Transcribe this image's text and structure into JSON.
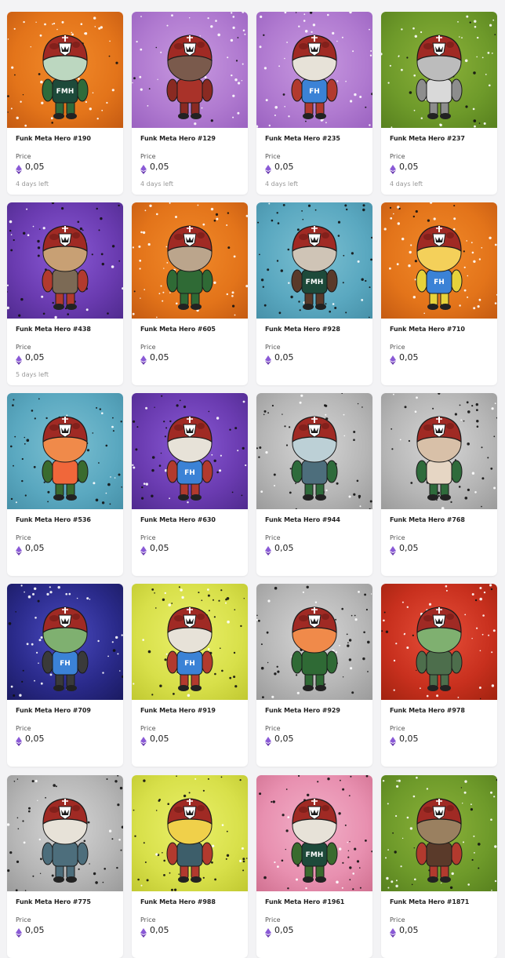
{
  "accent_color": "#8a5ad6",
  "price_label": "Price",
  "currency_icon": "ethereum-icon",
  "cards": [
    {
      "name": "Funk Meta Hero #190",
      "price": "0,05",
      "time_left": "4 days left",
      "bg": "orange",
      "shirt": "FMH",
      "shirt_color": "#1d4a3a",
      "skin": "#bcd7c0",
      "limbs": "#2e6b3b"
    },
    {
      "name": "Funk Meta Hero #129",
      "price": "0,05",
      "time_left": "4 days left",
      "bg": "purple",
      "shirt": "",
      "shirt_color": "#a93229",
      "skin": "#7a5a4c",
      "limbs": "#8a2a22"
    },
    {
      "name": "Funk Meta Hero #235",
      "price": "0,05",
      "time_left": "4 days left",
      "bg": "purple",
      "shirt": "FH",
      "shirt_color": "#3b82d6",
      "skin": "#e7e2d8",
      "limbs": "#b23a2e"
    },
    {
      "name": "Funk Meta Hero #237",
      "price": "0,05",
      "time_left": "4 days left",
      "bg": "green",
      "shirt": "",
      "shirt_color": "#d9d9d9",
      "skin": "#bcbcbc",
      "limbs": "#8d8d8d"
    },
    {
      "name": "Funk Meta Hero #438",
      "price": "0,05",
      "time_left": "5 days left",
      "bg": "violet",
      "shirt": "",
      "shirt_color": "#7c6a55",
      "skin": "#c8a074",
      "limbs": "#b23a2e"
    },
    {
      "name": "Funk Meta Hero #605",
      "price": "0,05",
      "time_left": "",
      "bg": "orange",
      "shirt": "",
      "shirt_color": "#2f6a35",
      "skin": "#bba58c",
      "limbs": "#2f6a35"
    },
    {
      "name": "Funk Meta Hero #928",
      "price": "0,05",
      "time_left": "",
      "bg": "teal",
      "shirt": "FMH",
      "shirt_color": "#1d4a3a",
      "skin": "#cfc4b6",
      "limbs": "#5a3a2a"
    },
    {
      "name": "Funk Meta Hero #710",
      "price": "0,05",
      "time_left": "",
      "bg": "orange",
      "shirt": "FH",
      "shirt_color": "#3b82d6",
      "skin": "#f4d05a",
      "limbs": "#e6d23a"
    },
    {
      "name": "Funk Meta Hero #536",
      "price": "0,05",
      "time_left": "",
      "bg": "teal",
      "shirt": "",
      "shirt_color": "#f0673a",
      "skin": "#f08a4a",
      "limbs": "#3a6b2e"
    },
    {
      "name": "Funk Meta Hero #630",
      "price": "0,05",
      "time_left": "",
      "bg": "violet",
      "shirt": "FH",
      "shirt_color": "#3b82d6",
      "skin": "#e7e2d8",
      "limbs": "#b23a2e"
    },
    {
      "name": "Funk Meta Hero #944",
      "price": "0,05",
      "time_left": "",
      "bg": "gray",
      "shirt": "",
      "shirt_color": "#4d6e7c",
      "skin": "#bcd0d6",
      "limbs": "#2e6b3b"
    },
    {
      "name": "Funk Meta Hero #768",
      "price": "0,05",
      "time_left": "",
      "bg": "gray",
      "shirt": "",
      "shirt_color": "#e6d6c4",
      "skin": "#d8c0a8",
      "limbs": "#2e6b3b"
    },
    {
      "name": "Funk Meta Hero #709",
      "price": "0,05",
      "time_left": "",
      "bg": "navy",
      "shirt": "FH",
      "shirt_color": "#3b82d6",
      "skin": "#7fb070",
      "limbs": "#3a3a3a"
    },
    {
      "name": "Funk Meta Hero #919",
      "price": "0,05",
      "time_left": "",
      "bg": "yellow",
      "shirt": "FH",
      "shirt_color": "#3b82d6",
      "skin": "#e7e2d8",
      "limbs": "#b23a2e"
    },
    {
      "name": "Funk Meta Hero #929",
      "price": "0,05",
      "time_left": "",
      "bg": "gray",
      "shirt": "",
      "shirt_color": "#2f6a35",
      "skin": "#f08a4a",
      "limbs": "#2f6a35"
    },
    {
      "name": "Funk Meta Hero #978",
      "price": "0,05",
      "time_left": "",
      "bg": "red",
      "shirt": "",
      "shirt_color": "#4d6e4c",
      "skin": "#7fb070",
      "limbs": "#4d6e4c"
    },
    {
      "name": "Funk Meta Hero #775",
      "price": "0,05",
      "time_left": "",
      "bg": "gray",
      "shirt": "",
      "shirt_color": "#4d6e7c",
      "skin": "#e7e2d8",
      "limbs": "#4d6e7c"
    },
    {
      "name": "Funk Meta Hero #988",
      "price": "0,05",
      "time_left": "",
      "bg": "yellow",
      "shirt": "",
      "shirt_color": "#3d5e6a",
      "skin": "#f0d04a",
      "limbs": "#b23a2e"
    },
    {
      "name": "Funk Meta Hero #1961",
      "price": "0,05",
      "time_left": "",
      "bg": "pink",
      "shirt": "FMH",
      "shirt_color": "#1d4a3a",
      "skin": "#e7e2d8",
      "limbs": "#3a6b2e"
    },
    {
      "name": "Funk Meta Hero #1871",
      "price": "0,05",
      "time_left": "",
      "bg": "green",
      "shirt": "",
      "shirt_color": "#5a3a2a",
      "skin": "#9a8060",
      "limbs": "#b23a2e"
    }
  ]
}
